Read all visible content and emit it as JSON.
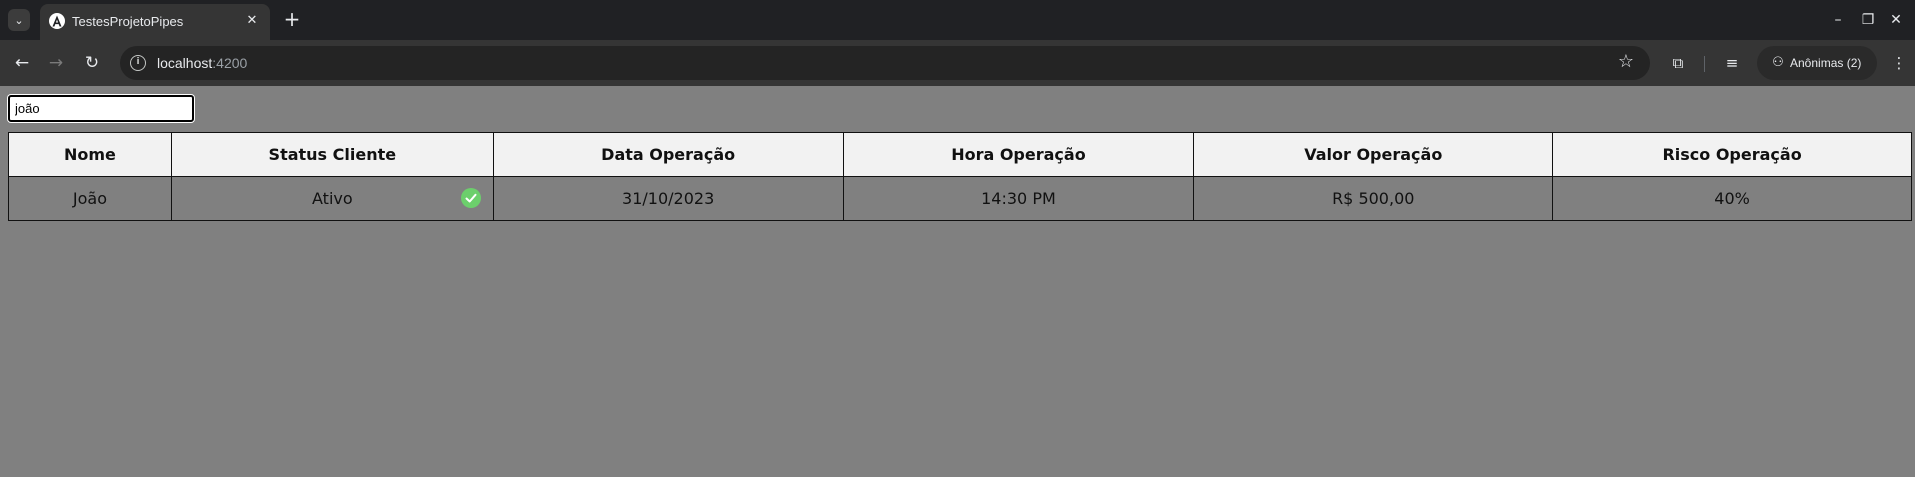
{
  "browser": {
    "tab_title": "TestesProjetoPipes",
    "url_host": "localhost",
    "url_port": ":4200",
    "profile_label": "Anônimas (2)"
  },
  "filter": {
    "value": "joão"
  },
  "table": {
    "headers": [
      "Nome",
      "Status Cliente",
      "Data Operação",
      "Hora Operação",
      "Valor Operação",
      "Risco Operação"
    ],
    "rows": [
      {
        "nome": "João",
        "status": "Ativo",
        "status_icon": "check-circle-icon",
        "data": "31/10/2023",
        "hora": "14:30 PM",
        "valor": "R$ 500,00",
        "risco": "40%"
      }
    ]
  },
  "colors": {
    "status_active": "#6ccf6c",
    "header_bg": "#f2f2f2",
    "page_bg": "#808080"
  }
}
